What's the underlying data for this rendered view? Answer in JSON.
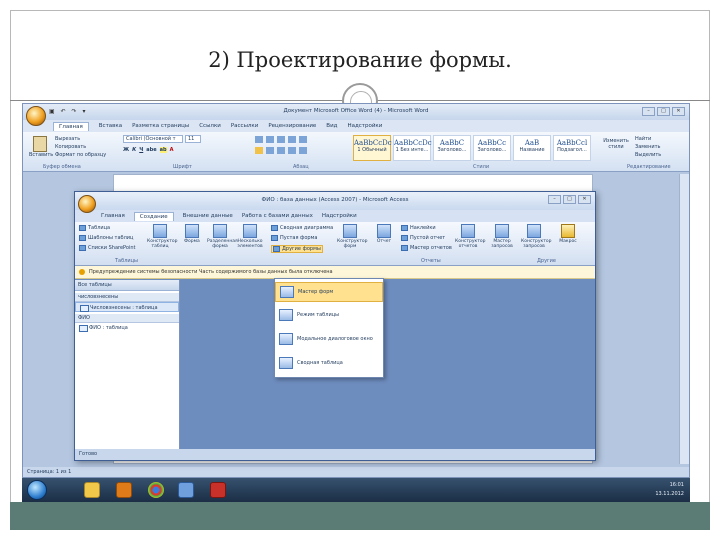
{
  "slide": {
    "title": "2) Проектирование формы."
  },
  "word": {
    "title": "Документ Microsoft Office Word (4) - Microsoft Word",
    "tabs": [
      "Главная",
      "Вставка",
      "Разметка страницы",
      "Ссылки",
      "Рассылки",
      "Рецензирование",
      "Вид",
      "Надстройки"
    ],
    "font_name": "Calibri (Основной т",
    "font_size": "11",
    "clipboard_label": "Буфер обмена",
    "font_label": "Шрифт",
    "paragraph_label": "Абзац",
    "styles_label": "Стили",
    "editing_label": "Редактирование",
    "paste_label": "Вставить",
    "cut_label": "Вырезать",
    "copy_label": "Копировать",
    "format_painter_label": "Формат по образцу",
    "styles": [
      {
        "sample": "AaBbCcDc",
        "name": "1 Обычный"
      },
      {
        "sample": "AaBbCcDc",
        "name": "1 Без инте..."
      },
      {
        "sample": "AaBbC",
        "name": "Заголово..."
      },
      {
        "sample": "AaBbCc",
        "name": "Заголово..."
      },
      {
        "sample": "AaB",
        "name": "Название"
      },
      {
        "sample": "AaBbCcl",
        "name": "Подзагол..."
      }
    ],
    "change_styles_label": "Изменить стили",
    "find_label": "Найти",
    "replace_label": "Заменить",
    "select_label": "Выделить",
    "status": "Страница: 1 из 1"
  },
  "access": {
    "title": "ФИО : база данных (Access 2007) - Microsoft Access",
    "tabs": [
      "Главная",
      "Создание",
      "Внешние данные",
      "Работа с базами данных",
      "Надстройки"
    ],
    "ribbon": {
      "table": "Таблица",
      "table_templates": "Шаблоны таблиц",
      "sharepoint_lists": "Списки SharePoint",
      "table_designer": "Конструктор таблиц",
      "tables_group": "Таблицы",
      "form": "Форма",
      "split_form": "Разделенная форма",
      "multiple_items": "Несколько элементов",
      "pivot_chart": "Сводная диаграмма",
      "blank_form": "Пустая форма",
      "other_forms": "Другие формы",
      "form_designer": "Конструктор форм",
      "report": "Отчет",
      "labels": "Наклейки",
      "blank_report": "Пустой отчет",
      "report_wizard": "Мастер отчетов",
      "report_designer": "Конструктор отчетов",
      "reports_group": "Отчеты",
      "query_wizard": "Мастер запросов",
      "query_designer": "Конструктор запросов",
      "macro": "Макрос",
      "other_group": "Другие"
    },
    "security_notice": "Предупреждение системы безопасности   Часть содержимого базы данных была отключена",
    "nav_pane": {
      "header": "Все таблицы",
      "groups": [
        {
          "name": "числовзнесены",
          "items": [
            "Числовзнесены : таблица"
          ]
        },
        {
          "name": "ФИО",
          "items": [
            "ФИО : таблица"
          ]
        }
      ]
    },
    "menu": [
      {
        "label": "Мастер форм",
        "highlighted": true
      },
      {
        "label": "Режим таблицы",
        "highlighted": false
      },
      {
        "label": "Модальное диалоговое окно",
        "highlighted": false
      },
      {
        "label": "Сводная таблица",
        "highlighted": false
      }
    ],
    "status": "Готово"
  },
  "taskbar": {
    "time": "16:01",
    "date": "13.11.2012"
  }
}
